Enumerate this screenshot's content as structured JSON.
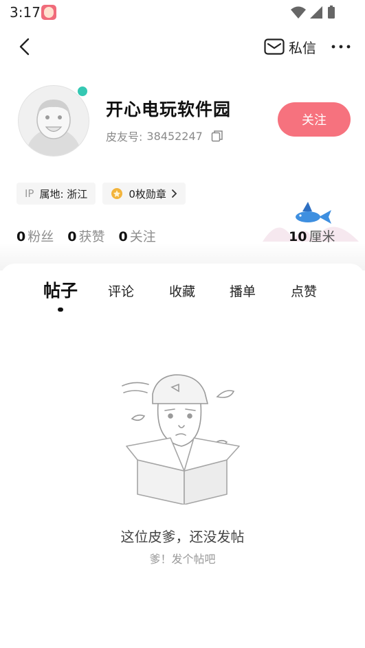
{
  "status_bar": {
    "time": "3:17"
  },
  "topbar": {
    "pm_label": "私信"
  },
  "profile": {
    "name": "开心电玩软件园",
    "id_label": "皮友号:",
    "id_value": "38452247",
    "follow_label": "关注",
    "ip_label": "IP",
    "location": "属地: 浙江",
    "medals_label": "0枚勋章"
  },
  "stats": [
    {
      "num": "0",
      "label": "粉丝"
    },
    {
      "num": "0",
      "label": "获赞"
    },
    {
      "num": "0",
      "label": "关注"
    }
  ],
  "length": {
    "num": "10",
    "label": "厘米"
  },
  "tabs": [
    "帖子",
    "评论",
    "收藏",
    "播单",
    "点赞"
  ],
  "empty": {
    "title": "这位皮爹，还没发帖",
    "subtitle": "爹！发个帖吧"
  },
  "colors": {
    "accent": "#f6727e",
    "online": "#35c8b3",
    "medal": "#f2b43c"
  }
}
